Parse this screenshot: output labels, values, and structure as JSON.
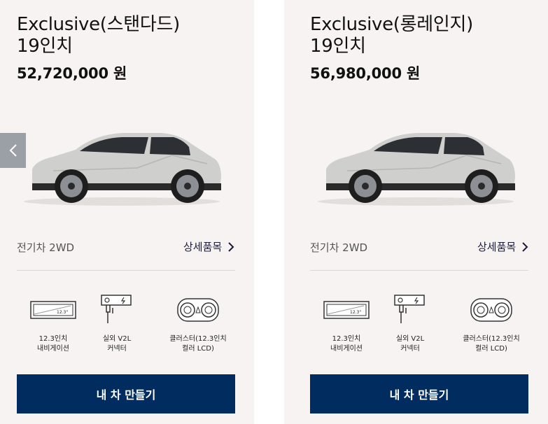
{
  "cards": [
    {
      "title_line1": "Exclusive(스탠다드)",
      "title_line2": "19인치",
      "price": "52,720,000 원",
      "engine": "전기차 2WD",
      "detail_link": "상세품목",
      "features": [
        {
          "icon": "navigation-screen-icon",
          "label": "12.3인치\n내비게이션",
          "badge": "12.3\""
        },
        {
          "icon": "v2l-connector-icon",
          "label": "실외 V2L\n커넥터"
        },
        {
          "icon": "cluster-lcd-icon",
          "label": "클러스터(12.3인치\n컬러 LCD)"
        }
      ],
      "cta": "내 차 만들기"
    },
    {
      "title_line1": "Exclusive(롱레인지)",
      "title_line2": "19인치",
      "price": "56,980,000 원",
      "engine": "전기차 2WD",
      "detail_link": "상세품목",
      "features": [
        {
          "icon": "navigation-screen-icon",
          "label": "12.3인치\n내비게이션",
          "badge": "12.3\""
        },
        {
          "icon": "v2l-connector-icon",
          "label": "실외 V2L\n커넥터"
        },
        {
          "icon": "cluster-lcd-icon",
          "label": "클러스터(12.3인치\n컬러 LCD)"
        }
      ],
      "cta": "내 차 만들기"
    }
  ],
  "carousel": {
    "prev_icon": "chevron-left-icon"
  },
  "colors": {
    "card_bg": "#f6f3f2",
    "cta_bg": "#002c5f",
    "arrow_bg": "#9aa0a6"
  }
}
